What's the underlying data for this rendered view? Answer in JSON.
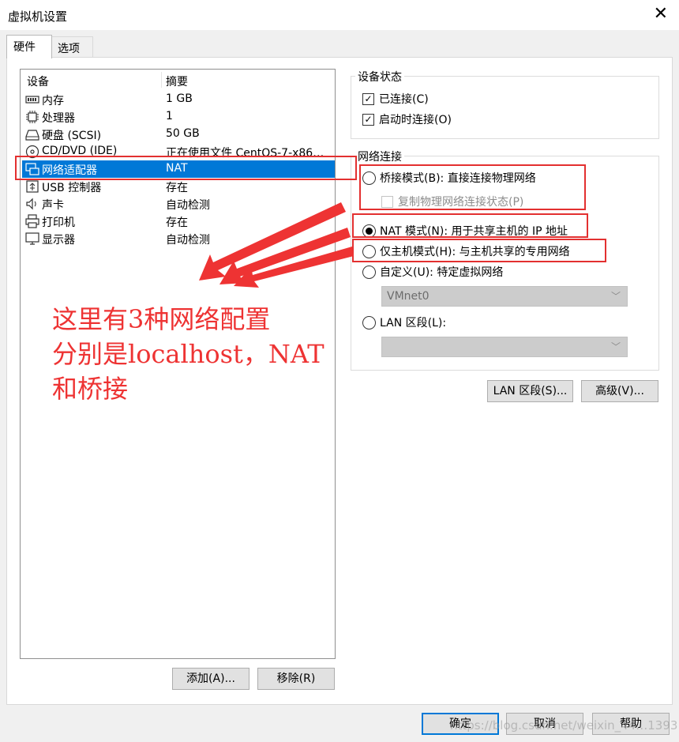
{
  "window": {
    "title": "虚拟机设置"
  },
  "tabs": [
    {
      "label": "硬件"
    },
    {
      "label": "选项"
    }
  ],
  "device_list": {
    "headers": [
      "设备",
      "摘要"
    ],
    "rows": [
      {
        "name": "内存",
        "summary": "1 GB",
        "icon": "memory-icon"
      },
      {
        "name": "处理器",
        "summary": "1",
        "icon": "processor-icon"
      },
      {
        "name": "硬盘 (SCSI)",
        "summary": "50 GB",
        "icon": "hard-disk-icon"
      },
      {
        "name": "CD/DVD (IDE)",
        "summary": "正在使用文件 CentOS-7-x86…",
        "icon": "cd-dvd-icon"
      },
      {
        "name": "网络适配器",
        "summary": "NAT",
        "icon": "network-adapter-icon",
        "selected": true
      },
      {
        "name": "USB 控制器",
        "summary": "存在",
        "icon": "usb-icon"
      },
      {
        "name": "声卡",
        "summary": "自动检测",
        "icon": "speaker-icon"
      },
      {
        "name": "打印机",
        "summary": "存在",
        "icon": "printer-icon"
      },
      {
        "name": "显示器",
        "summary": "自动检测",
        "icon": "monitor-icon"
      }
    ]
  },
  "buttons": {
    "add": "添加(A)...",
    "remove": "移除(R)",
    "lan_segments": "LAN 区段(S)...",
    "advanced": "高级(V)...",
    "ok": "确定",
    "cancel": "取消",
    "help": "帮助"
  },
  "device_status": {
    "label": "设备状态",
    "connected": {
      "label": "已连接(C)",
      "checked": true
    },
    "connect_at_power_on": {
      "label": "启动时连接(O)",
      "checked": true
    }
  },
  "network_connection": {
    "label": "网络连接",
    "bridged": {
      "label": "桥接模式(B): 直接连接物理网络",
      "selected": false
    },
    "replicate": {
      "label": "复制物理网络连接状态(P)",
      "checked": false,
      "disabled": true
    },
    "nat": {
      "label": "NAT 模式(N): 用于共享主机的 IP 地址",
      "selected": true
    },
    "host_only": {
      "label": "仅主机模式(H): 与主机共享的专用网络",
      "selected": false
    },
    "custom": {
      "label": "自定义(U): 特定虚拟网络",
      "selected": false
    },
    "custom_select": "VMnet0",
    "lan_segment": {
      "label": "LAN 区段(L):",
      "selected": false
    },
    "lan_select": ""
  },
  "annotation": {
    "lines": [
      "这里有3种网络配置",
      "分别是localhost，NAT",
      "和桥接"
    ],
    "color": "#ee3333"
  },
  "watermark": "https://blog.csdn.net/weixin_44…1393",
  "colors": {
    "selection": "#0078d7",
    "annotation_red": "#e33030"
  }
}
